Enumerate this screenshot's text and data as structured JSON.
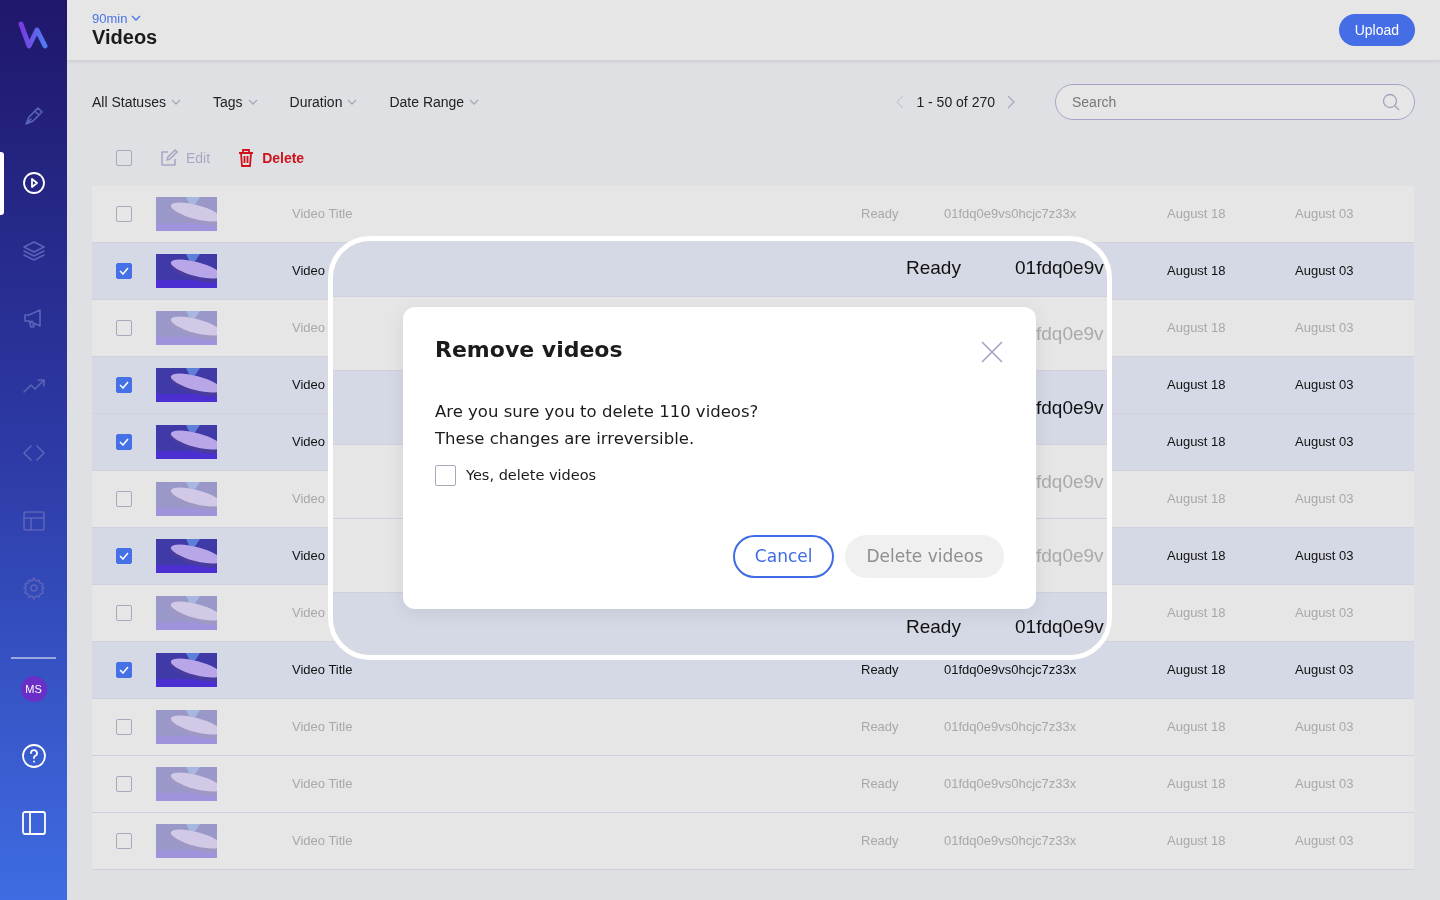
{
  "sidebar": {
    "items": [
      {
        "selected": false
      },
      {
        "selected": true
      },
      {
        "selected": false
      },
      {
        "selected": false
      },
      {
        "selected": false
      },
      {
        "selected": false
      },
      {
        "selected": false
      },
      {
        "selected": false
      }
    ],
    "avatar": "MS"
  },
  "header": {
    "project": "90min",
    "title": "Videos",
    "upload": "Upload"
  },
  "filters": [
    "All Statuses",
    "Tags",
    "Duration",
    "Date Range"
  ],
  "pagination": {
    "range": "1 - 50 of 270"
  },
  "search": {
    "placeholder": "Search"
  },
  "toolbar": {
    "select_all_checked": false,
    "edit": "Edit",
    "edit_disabled": true,
    "delete": "Delete"
  },
  "rows": [
    {
      "selected": false,
      "title": "Video Title",
      "status": "Ready",
      "id": "01fdq0e9vs0hcjc7z33x",
      "created": "August 18",
      "updated": "August 03"
    },
    {
      "selected": true,
      "title": "Video",
      "created": "August 18",
      "updated": "August 03"
    },
    {
      "selected": false,
      "title": "Video",
      "created": "August 18",
      "updated": "August 03"
    },
    {
      "selected": true,
      "title": "Video",
      "created": "August 18",
      "updated": "August 03"
    },
    {
      "selected": true,
      "title": "Video",
      "created": "August 18",
      "updated": "August 03"
    },
    {
      "selected": false,
      "title": "Video",
      "created": "August 18",
      "updated": "August 03"
    },
    {
      "selected": true,
      "title": "Video",
      "created": "August 18",
      "updated": "August 03"
    },
    {
      "selected": false,
      "title": "Video",
      "created": "August 18",
      "updated": "August 03"
    },
    {
      "selected": true,
      "title": "Video Title",
      "status": "Ready",
      "id": "01fdq0e9vs0hcjc7z33x",
      "created": "August 18",
      "updated": "August 03"
    },
    {
      "selected": false,
      "title": "Video Title",
      "status": "Ready",
      "id": "01fdq0e9vs0hcjc7z33x",
      "created": "August 18",
      "updated": "August 03"
    },
    {
      "selected": false,
      "title": "Video Title",
      "status": "Ready",
      "id": "01fdq0e9vs0hcjc7z33x",
      "created": "August 18",
      "updated": "August 03"
    },
    {
      "selected": false,
      "title": "Video Title",
      "status": "Ready",
      "id": "01fdq0e9vs0hcjc7z33x",
      "created": "August 18",
      "updated": "August 03"
    }
  ],
  "magnifier": {
    "rows": [
      {
        "selected": true,
        "status": "Ready",
        "id": "01fdq0e9v"
      },
      {
        "selected": false,
        "id": "fdq0e9v"
      },
      {
        "selected": true,
        "id": "fdq0e9v"
      },
      {
        "selected": false,
        "id": "fdq0e9v"
      },
      {
        "selected": false,
        "id": "fdq0e9v"
      },
      {
        "selected": true,
        "status": "Ready",
        "id": "01fdq0e9v"
      }
    ]
  },
  "modal": {
    "title": "Remove videos",
    "message": [
      "Are you sure you to delete 110 videos?",
      "These changes are irreversible."
    ],
    "confirm": {
      "label": "Yes, delete videos",
      "checked": false
    },
    "cancel": "Cancel",
    "delete": {
      "label": "Delete videos",
      "disabled": true
    }
  }
}
